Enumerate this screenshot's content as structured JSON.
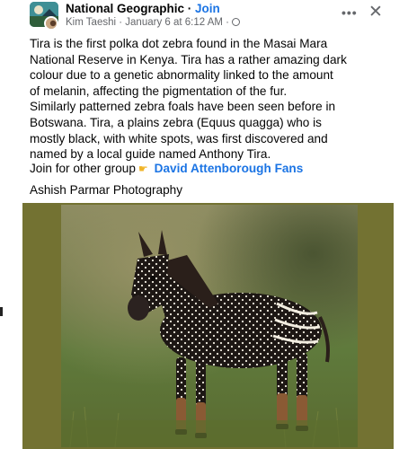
{
  "post": {
    "page_name": "National Geographic",
    "separator": " · ",
    "join_label": "Join",
    "author": "Kim Taeshi",
    "date": "January 6 at 6:12 AM",
    "more_icon": "more-horizontal-icon",
    "close_icon": "close-icon",
    "body_lines": [
      "Tira is the first polka dot zebra found in the Masai Mara",
      "National Reserve in Kenya. Tira has a rather amazing dark",
      "colour due to a genetic abnormality linked to the amount",
      "of melanin, affecting the pigmentation of the fur.",
      "Similarly patterned zebra foals have been seen before in",
      "Botswana. Tira, a plains zebra (Equus quagga) who is",
      "mostly black, with white spots, was first discovered and",
      "named by a local guide named Anthony Tira."
    ],
    "join_text": "Join for other group",
    "group_link": "David Attenborough Fans",
    "credit": "Ashish Parmar Photography",
    "photo_alt_icon": "polka-dot-zebra-photo"
  },
  "colors": {
    "link": "#1b74e4",
    "frame": "#737232",
    "meta": "#65676b"
  }
}
